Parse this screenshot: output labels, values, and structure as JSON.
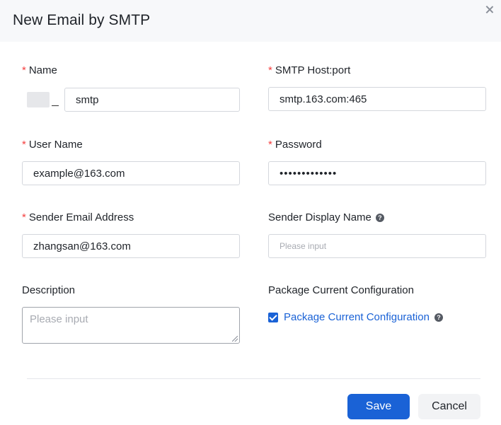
{
  "dialog": {
    "title": "New Email by SMTP"
  },
  "form": {
    "name": {
      "label": "Name",
      "required": "*",
      "value": "smtp"
    },
    "smtp_host": {
      "label": "SMTP Host:port",
      "required": "*",
      "value": "smtp.163.com:465"
    },
    "user_name": {
      "label": "User Name",
      "required": "*",
      "value": "example@163.com"
    },
    "password": {
      "label": "Password",
      "required": "*",
      "value": "•••••••••••••"
    },
    "sender_email": {
      "label": "Sender Email Address",
      "required": "*",
      "value": "zhangsan@163.com"
    },
    "sender_display_name": {
      "label": "Sender Display Name",
      "placeholder": "Please input"
    },
    "description": {
      "label": "Description",
      "placeholder": "Please input"
    },
    "package_config": {
      "label": "Package Current Configuration",
      "checkbox_label": "Package Current Configuration",
      "checked": true
    }
  },
  "footer": {
    "save_label": "Save",
    "cancel_label": "Cancel"
  },
  "icons": {
    "help": "?"
  },
  "colors": {
    "primary": "#1a62d6",
    "required": "#f53f3f",
    "header_bg": "#f7f8fa"
  }
}
